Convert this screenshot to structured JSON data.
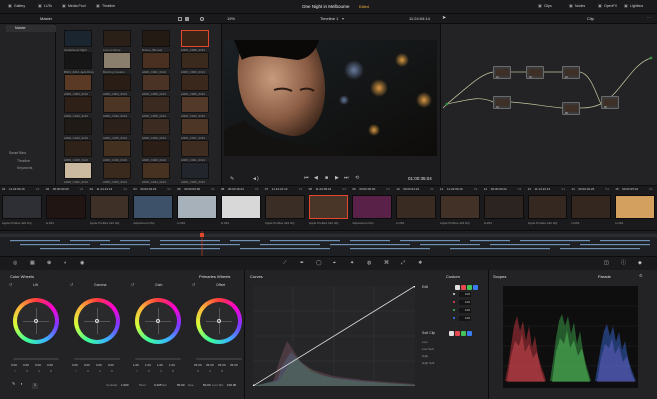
{
  "top_bar": {
    "items": [
      {
        "label": "Gallery",
        "icon": "gallery-icon"
      },
      {
        "label": "LUTs",
        "icon": "lut-icon"
      },
      {
        "label": "Media Pool",
        "icon": "media-pool-icon"
      },
      {
        "label": "Timeline",
        "icon": "timeline-icon"
      }
    ],
    "project_title": "One Night in Melbourne",
    "status": "Edited",
    "right_items": [
      {
        "label": "Clips",
        "icon": "clips-icon"
      },
      {
        "label": "Nodes",
        "icon": "nodes-icon"
      },
      {
        "label": "OpenFX",
        "icon": "openfx-icon"
      },
      {
        "label": "Lightbox",
        "icon": "lightbox-icon"
      }
    ]
  },
  "viewer_header": {
    "zoom": "19%",
    "timeline_name": "Timeline 1",
    "timecode": "11:24:04:14",
    "panel_label": "Clip"
  },
  "album": {
    "title": "Master",
    "items": [
      {
        "label": "Master"
      }
    ],
    "smart_bins_title": "Smart Bins",
    "smart_bins": [
      {
        "label": "Timeline"
      },
      {
        "label": "Keywords"
      }
    ]
  },
  "media_thumbs": [
    {
      "label": "Carbetta at Night",
      "color": "#1b2530"
    },
    {
      "label": "Love is Done",
      "color": "#2a2018"
    },
    {
      "label": "Dinner_Blurred",
      "color": "#241a14"
    },
    {
      "label": "A006_C008_0113",
      "color": "#3a2416"
    },
    {
      "label": "B001_0014 Jack Dinner",
      "color": "#161616"
    },
    {
      "label": "Buzzing Custom",
      "color": "#8a7f6c"
    },
    {
      "label": "A006_C001_0113",
      "color": "#4a3020"
    },
    {
      "label": "A006_C003_0113",
      "color": "#3a2a1e"
    },
    {
      "label": "A006_C003_0113",
      "color": "#5a3a24"
    },
    {
      "label": "A006_C004_0113",
      "color": "#2a1d15"
    },
    {
      "label": "A006_C005_0113",
      "color": "#4a3324"
    },
    {
      "label": "A006_C009_0113",
      "color": "#3b281c"
    },
    {
      "label": "A006_C010_0113",
      "color": "#2e1f17"
    },
    {
      "label": "A006_C010_0113",
      "color": "#4d3526"
    },
    {
      "label": "A006_C005_0113",
      "color": "#3a2a1f"
    },
    {
      "label": "A006_C012_0113",
      "color": "#53392a"
    },
    {
      "label": "A006_C013_0113",
      "color": "#1f1a16"
    },
    {
      "label": "A006_C015_0113",
      "color": "#2c211a"
    },
    {
      "label": "A006_C016_0113",
      "color": "#3c2b20"
    },
    {
      "label": "A006_C017_0113",
      "color": "#4e3627"
    },
    {
      "label": "A006_C018_0113",
      "color": "#2f2219"
    },
    {
      "label": "A006_C019_0113",
      "color": "#44301f"
    },
    {
      "label": "A006_C020_0113",
      "color": "#2a1e17"
    },
    {
      "label": "A006_C021_0113",
      "color": "#3e2c21"
    },
    {
      "label": "A006_C022_0113",
      "color": "#cbb9a0"
    },
    {
      "label": "A006_C023_0113",
      "color": "#3a2a1e"
    },
    {
      "label": "A006_C024_0113",
      "color": "#473222"
    },
    {
      "label": "A006_C025_0113",
      "color": "#22252c"
    }
  ],
  "viewer": {
    "timecode": "01:00:35:04"
  },
  "timeline_clips": [
    {
      "num": "01",
      "tc": "11:23:09:16",
      "v": "V1",
      "codec": "Apple ProRes 422 HQ",
      "color": "#2d2f35"
    },
    {
      "num": "02",
      "tc": "00:00:00:00",
      "v": "V1",
      "codec": "H.264",
      "color": "#201512"
    },
    {
      "num": "03",
      "tc": "11:14:21:13",
      "v": "V1",
      "codec": "Apple ProRes 422 HQ",
      "color": "#3e3026"
    },
    {
      "num": "04",
      "tc": "00:00:04:23",
      "v": "V1",
      "codec": "Adjustment Clip",
      "color": "#3d5268"
    },
    {
      "num": "05",
      "tc": "00:00:00:00",
      "v": "V1",
      "codec": "H.264",
      "color": "#a7b1ba"
    },
    {
      "num": "06",
      "tc": "00:00:16:24",
      "v": "V1",
      "codec": "H.264",
      "color": "#d8d8d8"
    },
    {
      "num": "07",
      "tc": "11:14:21:13",
      "v": "V1",
      "codec": "Apple ProRes 422 HQ",
      "color": "#3a2d25"
    },
    {
      "num": "08",
      "tc": "11:23:09:16",
      "v": "V1",
      "codec": "Apple ProRes 422 HQ",
      "color": "#4a3529"
    },
    {
      "num": "09",
      "tc": "00:00:00:00",
      "v": "V1",
      "codec": "Adjustment Clip",
      "color": "#5a2148"
    },
    {
      "num": "10",
      "tc": "00:00:04:23",
      "v": "V1",
      "codec": "H.264",
      "color": "#392b22"
    },
    {
      "num": "11",
      "tc": "11:23:09:16",
      "v": "V1",
      "codec": "Apple ProRes 422 HQ",
      "color": "#423126"
    },
    {
      "num": "12",
      "tc": "00:00:00:22",
      "v": "V1",
      "codec": "H.264",
      "color": "#2b2420"
    },
    {
      "num": "13",
      "tc": "11:14:21:13",
      "v": "V1",
      "codec": "Apple ProRes 422 HQ",
      "color": "#352820"
    },
    {
      "num": "14",
      "tc": "00:00:04:26",
      "v": "V1",
      "codec": "H.264",
      "color": "#34271f"
    },
    {
      "num": "15",
      "tc": "00:00:35:04",
      "v": "V1",
      "codec": "H.264",
      "color": "#d4a060"
    }
  ],
  "nodes": [
    {
      "label": "01",
      "color": "#3e3026"
    },
    {
      "label": "03",
      "color": "#3e3026"
    },
    {
      "label": "02",
      "color": "#3e3026"
    },
    {
      "label": "04",
      "color": "#3e3026"
    },
    {
      "label": "05",
      "color": "#3e3026"
    },
    {
      "label": "06",
      "color": "#3e3026"
    }
  ],
  "color_wheels": {
    "title": "Color Wheels",
    "mode": "Primaries Wheels",
    "wheels": [
      {
        "label": "Lift",
        "values": [
          "0.00",
          "0.00",
          "0.00",
          "0.00"
        ],
        "channels": [
          "Y",
          "R",
          "G",
          "B"
        ]
      },
      {
        "label": "Gamma",
        "values": [
          "0.00",
          "0.00",
          "0.00",
          "0.00"
        ],
        "channels": [
          "Y",
          "R",
          "G",
          "B"
        ]
      },
      {
        "label": "Gain",
        "values": [
          "1.00",
          "1.00",
          "1.00",
          "1.00"
        ],
        "channels": [
          "Y",
          "R",
          "G",
          "B"
        ]
      },
      {
        "label": "Offset",
        "values": [
          "25.00",
          "25.00",
          "25.00",
          "25.00"
        ],
        "channels": [
          "R",
          "G",
          "B",
          ""
        ]
      }
    ],
    "footer": [
      {
        "label": "Contrast",
        "value": "1.000"
      },
      {
        "label": "Pivot",
        "value": "0.435"
      },
      {
        "label": "Sat",
        "value": "50.00"
      },
      {
        "label": "Hue",
        "value": "50.00"
      },
      {
        "label": "Lum Mix",
        "value": "100.00"
      }
    ],
    "page_number": "1"
  },
  "curves": {
    "title": "Curves",
    "mode": "Custom"
  },
  "edit_panel": {
    "title": "Edit",
    "values": [
      "100",
      "100",
      "100",
      "100"
    ],
    "soft_clip_title": "Soft Clip",
    "soft_clip_items": [
      {
        "label": "Low"
      },
      {
        "label": "Low Soft"
      },
      {
        "label": "High"
      },
      {
        "label": "High Soft"
      }
    ]
  },
  "scopes": {
    "title": "Scopes",
    "mode": "Parade"
  },
  "colors": {
    "accent": "#e0472c",
    "status": "#f2b33d",
    "red": "#e5484d",
    "green": "#43c45a",
    "blue": "#3b7bf5"
  }
}
